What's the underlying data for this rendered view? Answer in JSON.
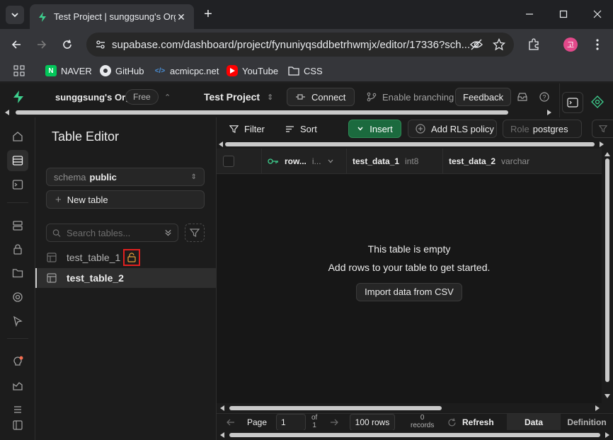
{
  "browser": {
    "tab_title": "Test Project | sunggsung's Org",
    "url": "supabase.com/dashboard/project/fynuniyqsddbetrhwmjx/editor/17336?sch...",
    "profile_initial": "고",
    "bookmarks": [
      {
        "label": "NAVER",
        "icon": "naver-icon"
      },
      {
        "label": "GitHub",
        "icon": "github-icon"
      },
      {
        "label": "acmicpc.net",
        "icon": "code-icon"
      },
      {
        "label": "YouTube",
        "icon": "youtube-icon"
      },
      {
        "label": "CSS",
        "icon": "folder-icon"
      }
    ]
  },
  "header": {
    "org_name": "sunggsung's Org",
    "plan_badge": "Free",
    "project_name": "Test Project",
    "connect_label": "Connect",
    "branching_label": "Enable branching",
    "feedback_label": "Feedback"
  },
  "sidebar": {
    "title": "Table Editor",
    "schema_label": "schema",
    "schema_value": "public",
    "new_table_label": "New table",
    "search_placeholder": "Search tables...",
    "tables": [
      {
        "name": "test_table_1",
        "active": false,
        "unlocked": true
      },
      {
        "name": "test_table_2",
        "active": true,
        "unlocked": false
      }
    ]
  },
  "toolbar": {
    "filter_label": "Filter",
    "sort_label": "Sort",
    "insert_label": "Insert",
    "rls_label": "Add RLS policy",
    "role_label": "Role",
    "role_value": "postgres"
  },
  "grid": {
    "columns": [
      {
        "name": "row...",
        "type": "i...",
        "primary_key": true
      },
      {
        "name": "test_data_1",
        "type": "int8"
      },
      {
        "name": "test_data_2",
        "type": "varchar"
      }
    ],
    "empty_title": "This table is empty",
    "empty_subtitle": "Add rows to your table to get started.",
    "import_label": "Import data from CSV"
  },
  "footer": {
    "page_label": "Page",
    "page_value": "1",
    "of_label": "of",
    "of_value": "1",
    "rows_per_page": "100 rows",
    "records_count": "0",
    "records_label": "records",
    "refresh_label": "Refresh",
    "tab_data": "Data",
    "tab_definition": "Definition"
  },
  "colors": {
    "brand_green": "#3ecf8e",
    "insert_bg": "#1b6a3e",
    "highlight_red": "#e0201f"
  }
}
